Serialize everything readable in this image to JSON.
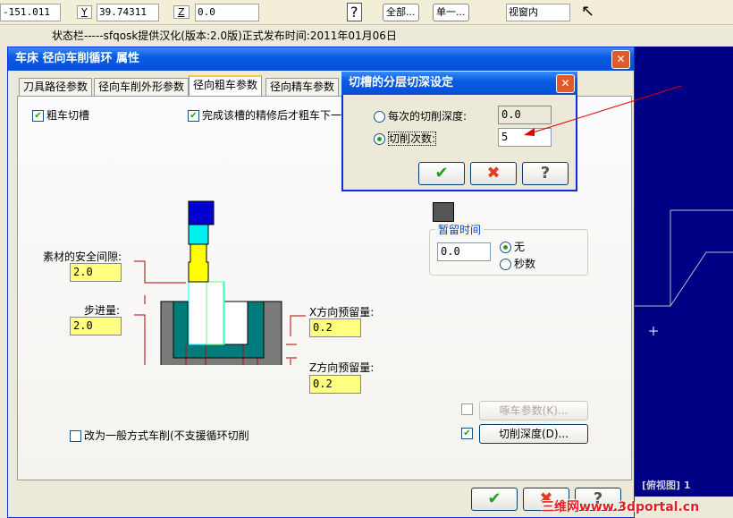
{
  "toolbar": {
    "x_value": "-151.011",
    "y_label": "Y",
    "y_value": "39.74311",
    "z_label": "Z",
    "z_value": "0.0",
    "all_btn": "全部...",
    "single_btn": "单一...",
    "view_select": "视窗内"
  },
  "status_text": "状态栏-----sfqosk提供汉化(版本:2.0版)正式发布时间:2011年01月06日",
  "dialog": {
    "title": "车床 径向车削循环 属性",
    "tabs": [
      "刀具路径参数",
      "径向车削外形参数",
      "径向粗车参数",
      "径向精车参数"
    ],
    "active_tab": 2,
    "rough_groove": {
      "label": "粗车切槽",
      "checked": true
    },
    "finish_first": {
      "label": "完成该槽的精修后才粗车下一",
      "checked": true
    },
    "safety_clearance": {
      "label": "素材的安全间隙:",
      "value": "2.0"
    },
    "step": {
      "label": "步进量:",
      "value": "2.0"
    },
    "x_stock": {
      "label": "X方向预留量:",
      "value": "0.2"
    },
    "z_stock": {
      "label": "Z方向预留量:",
      "value": "0.2"
    },
    "general_turning": {
      "label": "改为一般方式车削(不支援循环切削",
      "checked": false
    },
    "dwell": {
      "label": "暂留时间",
      "value": "0.0",
      "options": [
        "无",
        "秒数"
      ],
      "selected": "无"
    },
    "peck": {
      "label": "啄车参数(K)...",
      "checked": false,
      "enabled": false
    },
    "depth_cut": {
      "label": "切削深度(D)...",
      "checked": true
    },
    "ok_icon": "check-icon",
    "cancel_icon": "x-icon",
    "help_icon": "question-icon"
  },
  "subdialog": {
    "title": "切槽的分层切深设定",
    "per_depth": {
      "label": "每次的切削深度:",
      "value": "0.0",
      "selected": false
    },
    "num_cuts": {
      "label": "切削次数:",
      "value": "5",
      "selected": true
    }
  },
  "viewport": {
    "label": "[俯视图] 1",
    "background": "#000085"
  },
  "watermark": "三维网www.3dportal.cn"
}
